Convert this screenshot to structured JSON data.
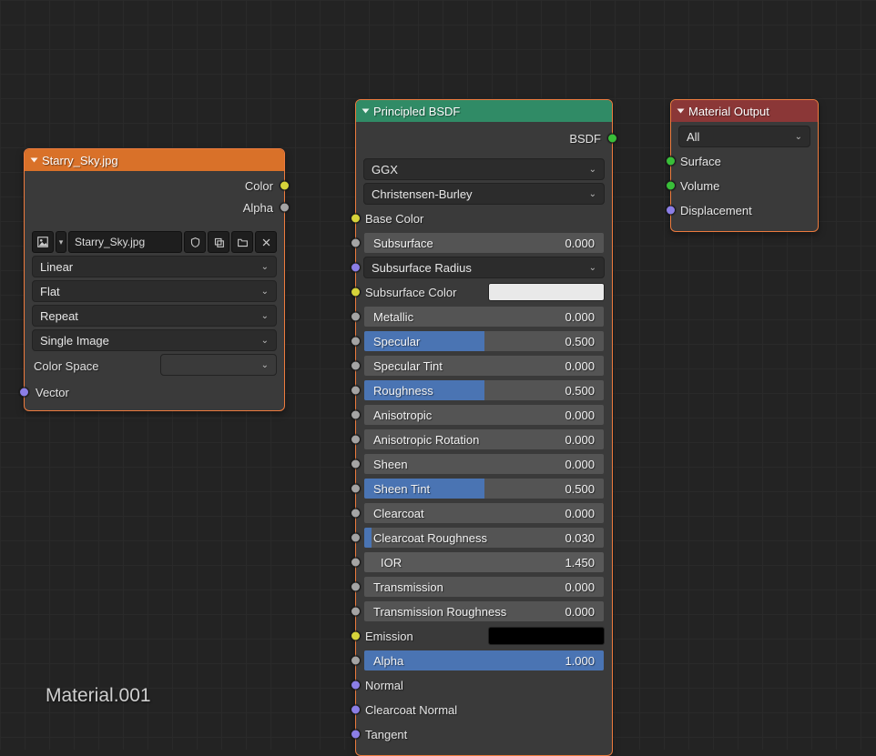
{
  "material_name": "Material.001",
  "image_node": {
    "title": "Starry_Sky.jpg",
    "outputs": {
      "color": "Color",
      "alpha": "Alpha"
    },
    "filename": "Starry_Sky.jpg",
    "interpolation": "Linear",
    "projection": "Flat",
    "extension": "Repeat",
    "source": "Single Image",
    "colorspace_label": "Color Space",
    "vector_input": "Vector"
  },
  "bsdf_node": {
    "title": "Principled BSDF",
    "output": "BSDF",
    "distribution": "GGX",
    "subsurface_method": "Christensen-Burley",
    "base_color_label": "Base Color",
    "subsurface_color_label": "Subsurface Color",
    "emission_label": "Emission",
    "subsurface_radius_label": "Subsurface Radius",
    "normal_label": "Normal",
    "clearcoat_normal_label": "Clearcoat Normal",
    "tangent_label": "Tangent",
    "sliders": [
      {
        "label": "Subsurface",
        "value": "0.000",
        "fill": 0
      },
      {
        "label": "Metallic",
        "value": "0.000",
        "fill": 0
      },
      {
        "label": "Specular",
        "value": "0.500",
        "fill": 50
      },
      {
        "label": "Specular Tint",
        "value": "0.000",
        "fill": 0
      },
      {
        "label": "Roughness",
        "value": "0.500",
        "fill": 50
      },
      {
        "label": "Anisotropic",
        "value": "0.000",
        "fill": 0
      },
      {
        "label": "Anisotropic Rotation",
        "value": "0.000",
        "fill": 0
      },
      {
        "label": "Sheen",
        "value": "0.000",
        "fill": 0
      },
      {
        "label": "Sheen Tint",
        "value": "0.500",
        "fill": 50
      },
      {
        "label": "Clearcoat",
        "value": "0.000",
        "fill": 0
      },
      {
        "label": "Clearcoat Roughness",
        "value": "0.030",
        "fill": 3
      },
      {
        "label": "IOR",
        "value": "1.450",
        "fill": 0,
        "nofill": true
      },
      {
        "label": "Transmission",
        "value": "0.000",
        "fill": 0
      },
      {
        "label": "Transmission Roughness",
        "value": "0.000",
        "fill": 0
      },
      {
        "label": "Alpha",
        "value": "1.000",
        "fill": 100
      }
    ],
    "colors": {
      "subsurface_color": "#e9e9e9",
      "emission": "#000000"
    }
  },
  "output_node": {
    "title": "Material Output",
    "target": "All",
    "surface": "Surface",
    "volume": "Volume",
    "displacement": "Displacement"
  }
}
